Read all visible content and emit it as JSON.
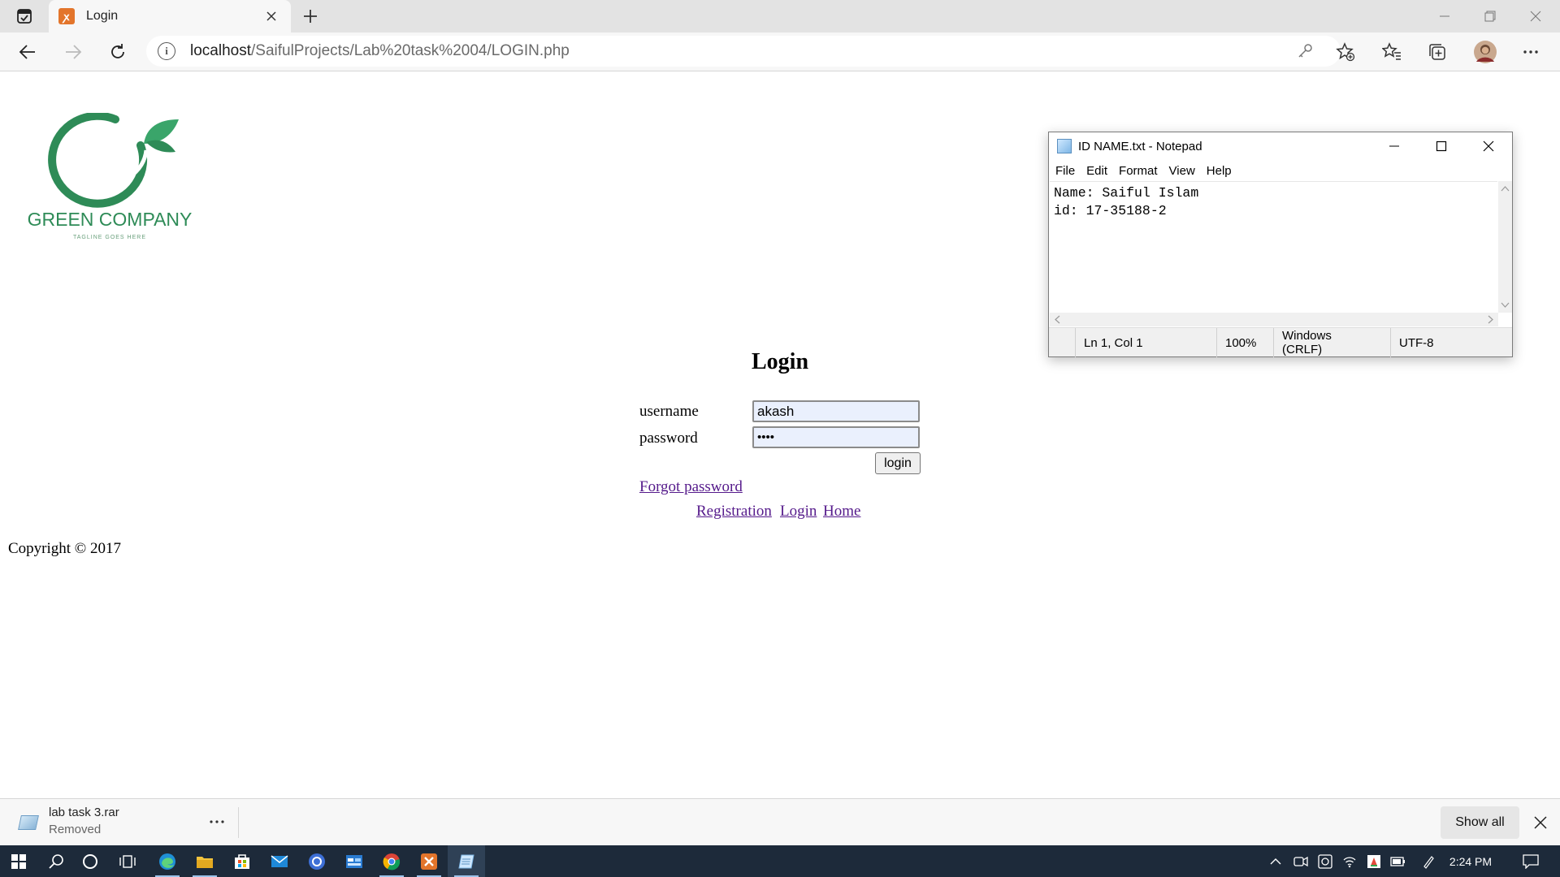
{
  "browser": {
    "tab": {
      "title": "Login",
      "favicon": "xampp-icon"
    },
    "url": {
      "host": "localhost",
      "path": "/SaifulProjects/Lab%20task%2004/LOGIN.php"
    }
  },
  "page": {
    "logo": {
      "name": "GREEN COMPANY",
      "tagline": "TAGLINE GOES HERE",
      "color": "#2e8b57"
    },
    "title": "Login",
    "form": {
      "username_label": "username",
      "username_value": "akash",
      "password_label": "password",
      "password_value": "••••",
      "submit_label": "login"
    },
    "links": {
      "forgot": "Forgot password",
      "registration": "Registration",
      "login": "Login",
      "home": "Home"
    },
    "footer": "Copyright © 2017"
  },
  "notepad": {
    "title": "ID NAME.txt - Notepad",
    "menu": [
      "File",
      "Edit",
      "Format",
      "View",
      "Help"
    ],
    "lines": [
      "Name: Saiful Islam",
      "id: 17-35188-2"
    ],
    "status": {
      "position": "Ln 1, Col 1",
      "zoom": "100%",
      "line_ending": "Windows (CRLF)",
      "encoding": "UTF-8"
    }
  },
  "downloads": {
    "item_name": "lab task 3.rar",
    "item_status": "Removed",
    "show_all": "Show all"
  },
  "taskbar": {
    "time": "2:24 PM"
  },
  "colors": {
    "link": "#551a8b",
    "taskbar": "#1d2a3a",
    "input_bg": "#eaf0fd"
  }
}
